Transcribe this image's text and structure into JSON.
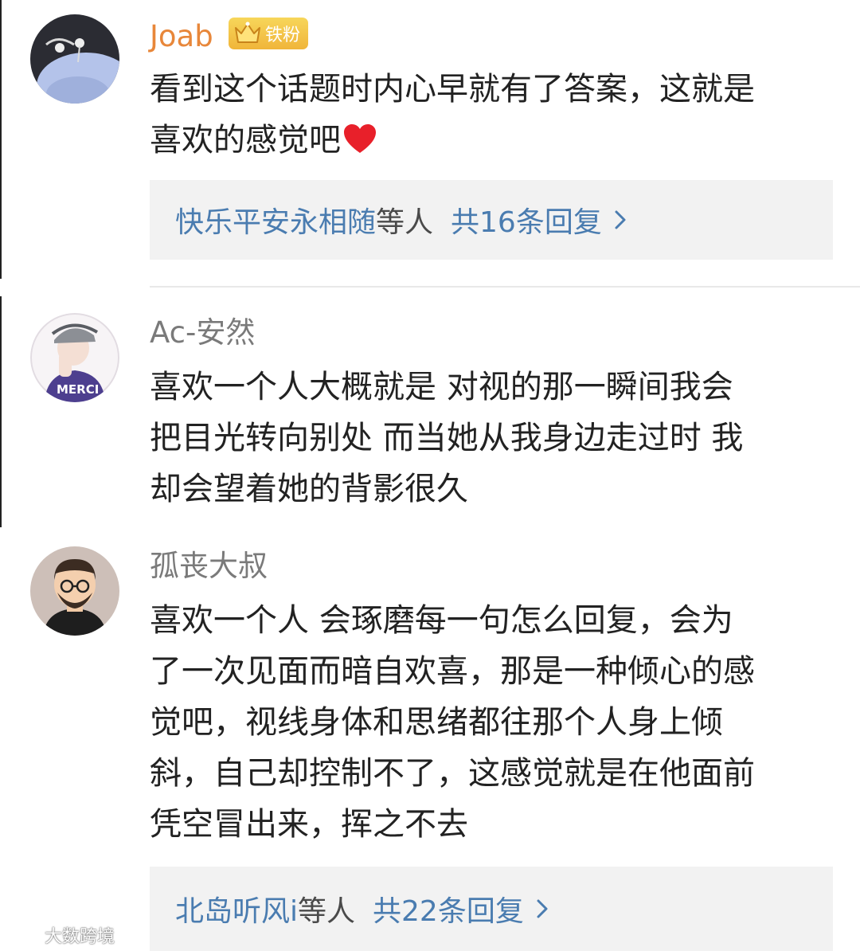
{
  "comments": [
    {
      "user": "Joab",
      "badge": "铁粉",
      "lines": [
        "看到这个话题时内心早就有了答案，这就是",
        "喜欢的感觉吧"
      ],
      "reply_names": "快乐平安永相随",
      "reply_suffix": "等人",
      "reply_count": "共16条回复"
    },
    {
      "user": "Ac-安然",
      "lines": [
        "喜欢一个人大概就是 对视的那一瞬间我会",
        "把目光转向别处 而当她从我身边走过时 我",
        "却会望着她的背影很久"
      ]
    },
    {
      "user": "孤丧大叔",
      "lines": [
        "喜欢一个人 会琢磨每一句怎么回复，会为",
        "了一次见面而暗自欢喜，那是一种倾心的感",
        "觉吧，视线身体和思绪都往那个人身上倾",
        "斜，自己却控制不了，这感觉就是在他面前",
        "凭空冒出来，挥之不去"
      ],
      "reply_names": "北岛听风i",
      "reply_suffix": "等人",
      "reply_count": "共22条回复"
    }
  ],
  "avatar_2_shirt_text": "MERCI",
  "watermark": "大数跨境",
  "colors": {
    "username_vip": "#e8873a",
    "username": "#7a7a7a",
    "link": "#4a7cb0",
    "reply_bg": "#f2f2f2",
    "badge": "#f0b53a",
    "heart": "#e8202a"
  }
}
